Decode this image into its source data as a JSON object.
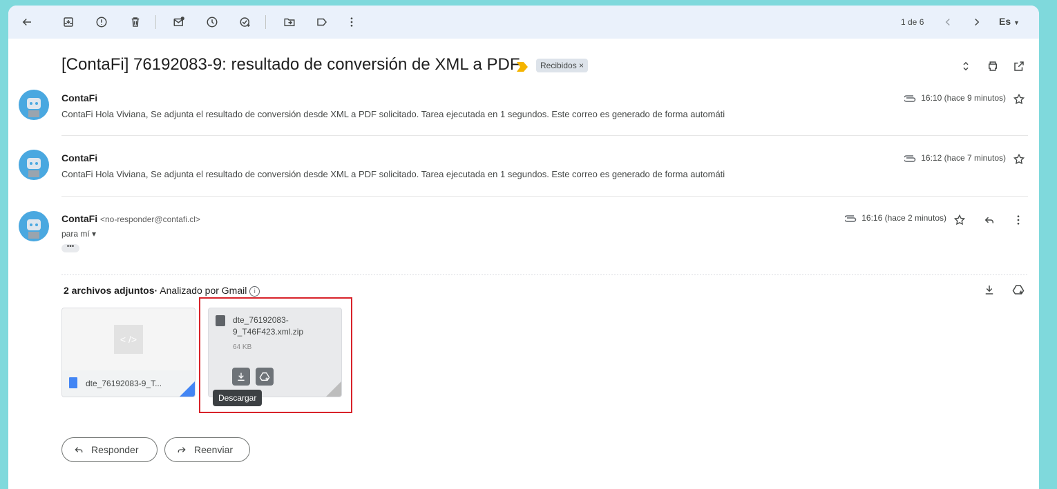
{
  "toolbar": {
    "pager": "1 de 6",
    "lang": "Es"
  },
  "thread": {
    "subject": "[ContaFi] 76192083-9: resultado de conversión de XML a PDF",
    "label": "Recibidos ×"
  },
  "messages": [
    {
      "sender": "ContaFi",
      "snippet": "ContaFi Hola Viviana, Se adjunta el resultado de conversión desde XML a PDF solicitado. Tarea ejecutada en 1 segundos. Este correo es generado de forma automáti",
      "time": "16:10 (hace 9 minutos)"
    },
    {
      "sender": "ContaFi",
      "snippet": "ContaFi Hola Viviana, Se adjunta el resultado de conversión desde XML a PDF solicitado. Tarea ejecutada en 1 segundos. Este correo es generado de forma automáti",
      "time": "16:12 (hace 7 minutos)"
    },
    {
      "sender": "ContaFi",
      "address": "<no-responder@contafi.cl>",
      "to": "para mí ▾",
      "time": "16:16 (hace 2 minutos)",
      "dots": "•••"
    }
  ],
  "attachments": {
    "count_label": "2 archivos adjuntos",
    "scanned": "Analizado por Gmail",
    "info": "i",
    "items": [
      {
        "name": "dte_76192083-9_T...",
        "thumb": "< />"
      },
      {
        "name": "dte_76192083-9_T46F423.xml.zip",
        "size": "64 KB"
      }
    ],
    "tooltip": "Descargar"
  },
  "actions": {
    "reply": "Responder",
    "forward": "Reenviar"
  },
  "colors": {
    "background": "#7fd9dc",
    "toolbar": "#eaf1fb",
    "highlight": "#d8232a",
    "avatar": "#4aa8e0",
    "important": "#f5b400"
  }
}
